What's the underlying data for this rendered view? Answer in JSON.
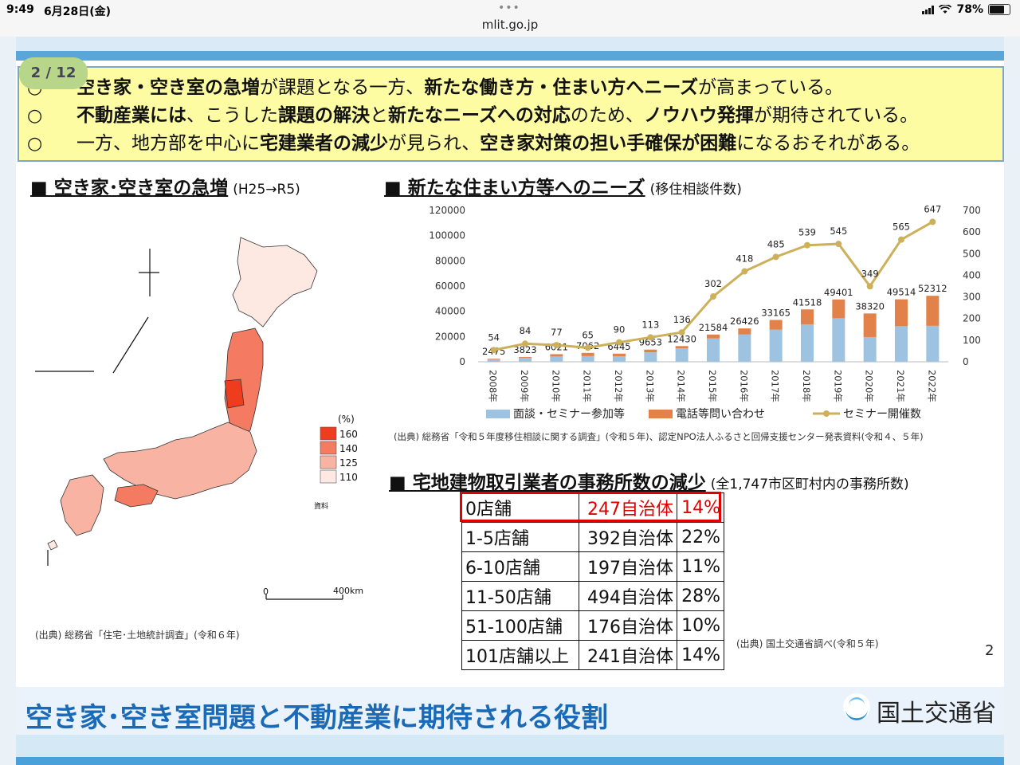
{
  "status_bar": {
    "time": "9:49",
    "date": "6月28日(金)",
    "url": "mlit.go.jp",
    "battery": "78%"
  },
  "page_badge": "2 / 12",
  "bullets": [
    {
      "marker": "○",
      "parts": [
        {
          "t": "空き家・空き室の急増",
          "b": true
        },
        {
          "t": "が課題となる一方、",
          "b": false
        },
        {
          "t": "新たな働き方・住まい方へニーズ",
          "b": true
        },
        {
          "t": "が高まっている。",
          "b": false
        }
      ]
    },
    {
      "marker": "○",
      "parts": [
        {
          "t": "不動産業には",
          "b": true
        },
        {
          "t": "、こうした",
          "b": false
        },
        {
          "t": "課題の解決",
          "b": true
        },
        {
          "t": "と",
          "b": false
        },
        {
          "t": "新たなニーズへの対応",
          "b": true
        },
        {
          "t": "のため、",
          "b": false
        },
        {
          "t": "ノウハウ発揮",
          "b": true
        },
        {
          "t": "が期待されている。",
          "b": false
        }
      ]
    },
    {
      "marker": "○",
      "parts": [
        {
          "t": "一方、地方部を中心に",
          "b": false
        },
        {
          "t": "宅建業者の減少",
          "b": true
        },
        {
          "t": "が見られ、",
          "b": false
        },
        {
          "t": "空き家対策の担い手確保が困難",
          "b": true
        },
        {
          "t": "になるおそれがある。",
          "b": false
        }
      ]
    }
  ],
  "section_vacancy": {
    "title": "■ 空き家･空き室の急増",
    "sub": "(H25→R5)"
  },
  "section_needs": {
    "title": "■ 新たな住まい方等へのニーズ",
    "sub": "(移住相談件数)"
  },
  "section_offices": {
    "title": "■ 宅地建物取引業者の事務所数の減少",
    "sub": "(全1,747市区町村内の事務所数)"
  },
  "map": {
    "legend_title": "(%)",
    "legend": [
      {
        "label": "160",
        "color": "#f03c1e"
      },
      {
        "label": "140",
        "color": "#f47a62"
      },
      {
        "label": "125",
        "color": "#f8b3a3"
      },
      {
        "label": "110",
        "color": "#fde8e2"
      }
    ],
    "note": "資料",
    "scale_zero": "0",
    "scale_label": "400km",
    "source": "(出典) 総務省「住宅･土地統計調査」(令和６年)"
  },
  "chart_data": {
    "type": "bar",
    "categories": [
      "2008年",
      "2009年",
      "2010年",
      "2011年",
      "2012年",
      "2013年",
      "2014年",
      "2015年",
      "2016年",
      "2017年",
      "2018年",
      "2019年",
      "2020年",
      "2021年",
      "2022年"
    ],
    "series": [
      {
        "name": "面談・セミナー参加等",
        "type": "bar",
        "stack": "total",
        "color": "#9ec3e0",
        "values": [
          2000,
          3200,
          4200,
          4500,
          4400,
          7500,
          10700,
          18500,
          21600,
          25400,
          29700,
          34500,
          19600,
          28200,
          28500
        ]
      },
      {
        "name": "電話等問い合わせ",
        "type": "bar",
        "stack": "total",
        "color": "#e2824a",
        "values": [
          475,
          623,
          1821,
          2562,
          2045,
          2153,
          1730,
          3084,
          4826,
          7765,
          11818,
          14901,
          18720,
          21314,
          23812
        ]
      },
      {
        "name": "セミナー開催数",
        "type": "line",
        "axis": "right",
        "color": "#cdb05a",
        "values": [
          54,
          84,
          77,
          65,
          90,
          113,
          136,
          302,
          418,
          485,
          539,
          545,
          349,
          565,
          647
        ]
      }
    ],
    "totals": [
      2475,
      3823,
      6021,
      7062,
      6445,
      9653,
      12430,
      21584,
      26426,
      33165,
      41518,
      49401,
      38320,
      49514,
      52312
    ],
    "ylim": [
      0,
      120000
    ],
    "yticks": [
      0,
      20000,
      40000,
      60000,
      80000,
      100000,
      120000
    ],
    "y2lim": [
      0,
      700
    ],
    "y2ticks": [
      0,
      100,
      200,
      300,
      400,
      500,
      600,
      700
    ],
    "legend_position": "bottom",
    "source": "(出典) 総務省「令和５年度移住相談に関する調査」(令和５年)、認定NPO法人ふるさと回帰支援センター発表資料(令和４、５年)"
  },
  "offices_table": {
    "rows": [
      {
        "label": "0店舗",
        "count": "247自治体",
        "pct": "14%",
        "highlight": true
      },
      {
        "label": "1-5店舗",
        "count": "392自治体",
        "pct": "22%",
        "highlight": false
      },
      {
        "label": "6-10店舗",
        "count": "197自治体",
        "pct": "11%",
        "highlight": false
      },
      {
        "label": "11-50店舗",
        "count": "494自治体",
        "pct": "28%",
        "highlight": false
      },
      {
        "label": "51-100店舗",
        "count": "176自治体",
        "pct": "10%",
        "highlight": false
      },
      {
        "label": "101店舗以上",
        "count": "241自治体",
        "pct": "14%",
        "highlight": false
      }
    ],
    "source": "(出典) 国土交通省調べ(令和５年)"
  },
  "page_number": "2",
  "footer": {
    "title": "空き家･空き室問題と不動産業に期待される役割",
    "ministry": "国土交通省"
  }
}
